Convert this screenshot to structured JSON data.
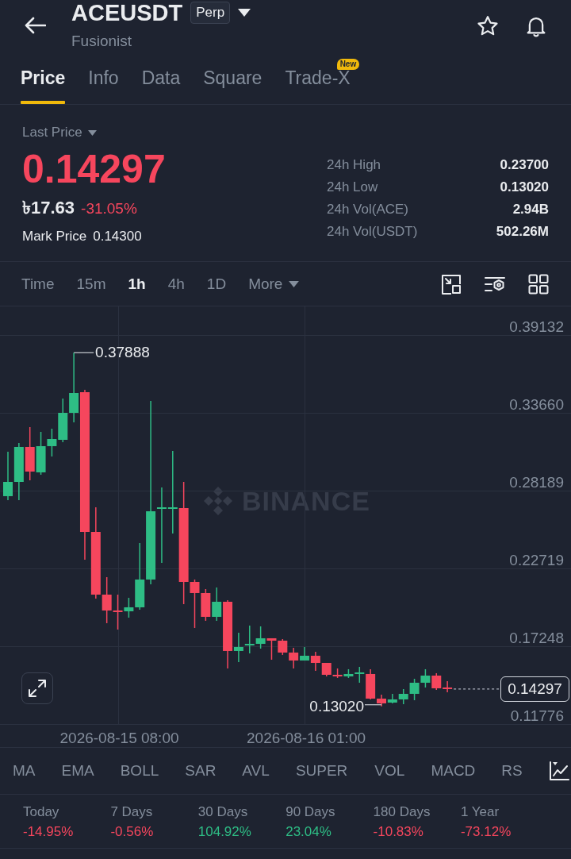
{
  "header": {
    "title": "ACEUSDT",
    "badge": "Perp",
    "subtitle": "Fusionist"
  },
  "tabs": [
    {
      "label": "Price",
      "selected": true
    },
    {
      "label": "Info",
      "selected": false
    },
    {
      "label": "Data",
      "selected": false
    },
    {
      "label": "Square",
      "selected": false
    },
    {
      "label": "Trade-X",
      "selected": false,
      "badge": "New"
    }
  ],
  "price": {
    "label": "Last Price",
    "value": "0.14297",
    "down": true,
    "fiat_value": "৳17.63",
    "change": "-31.05%",
    "mark_price_label": "Mark Price",
    "mark_price": "0.14300"
  },
  "stats_24h": [
    {
      "label": "24h High",
      "value": "0.23700"
    },
    {
      "label": "24h Low",
      "value": "0.13020"
    },
    {
      "label": "24h Vol(ACE)",
      "value": "2.94B"
    },
    {
      "label": "24h Vol(USDT)",
      "value": "502.26M"
    }
  ],
  "intervals": [
    {
      "label": "Time",
      "kind": "option",
      "selected": false
    },
    {
      "label": "15m",
      "kind": "option",
      "selected": false
    },
    {
      "label": "1h",
      "kind": "option",
      "selected": true
    },
    {
      "label": "4h",
      "kind": "option",
      "selected": false
    },
    {
      "label": "1D",
      "kind": "option",
      "selected": false
    },
    {
      "label": "More",
      "kind": "dropdown",
      "selected": false
    }
  ],
  "chart": {
    "high_marker": "0.37888",
    "low_marker": "0.13020",
    "current_price_tag": "0.14297",
    "watermark": "BINANCE",
    "chart_data": {
      "type": "candlestick",
      "categories": [
        null,
        null,
        null,
        null,
        null,
        null,
        null,
        null,
        null,
        null,
        "2026-08-15 08:00",
        null,
        null,
        null,
        null,
        null,
        null,
        null,
        null,
        null,
        null,
        null,
        null,
        null,
        null,
        null,
        null,
        "2026-08-16 01:00",
        null,
        null,
        null,
        null,
        null,
        null,
        null,
        null,
        null,
        null,
        null,
        null,
        null
      ],
      "ohlc": [
        [
          0.278,
          0.30926,
          0.2752,
          0.28804
        ],
        [
          0.28804,
          0.3154,
          0.2752,
          0.31261
        ],
        [
          0.31261,
          0.32656,
          0.28916,
          0.2953
        ],
        [
          0.29474,
          0.32321,
          0.29307,
          0.31317
        ],
        [
          0.31317,
          0.32545,
          0.30591,
          0.31819
        ],
        [
          0.31763,
          0.34666,
          0.31596,
          0.33661
        ],
        [
          0.33661,
          0.37888,
          0.32991,
          0.35057
        ],
        [
          0.35113,
          0.3528,
          0.23334,
          0.25287
        ],
        [
          0.25287,
          0.27018,
          0.20598,
          0.20877
        ],
        [
          0.20877,
          0.22105,
          0.18868,
          0.19761
        ],
        [
          0.19761,
          0.20877,
          0.18421,
          0.19649
        ],
        [
          0.19705,
          0.20654,
          0.19258,
          0.19984
        ],
        [
          0.19984,
          0.24506,
          0.19817,
          0.21938
        ],
        [
          0.21938,
          0.34499,
          0.21603,
          0.26739
        ],
        [
          0.26906,
          0.28414,
          0.2311,
          0.27018
        ],
        [
          0.26906,
          0.30982,
          0.25176,
          0.27018
        ],
        [
          0.26962,
          0.28804,
          0.20207,
          0.2177
        ],
        [
          0.2177,
          0.21938,
          0.18533,
          0.20989
        ],
        [
          0.20989,
          0.21268,
          0.19035,
          0.19314
        ],
        [
          0.19314,
          0.2138,
          0.19035,
          0.20375
        ],
        [
          0.20375,
          0.20486,
          0.15686,
          0.16914
        ],
        [
          0.16914,
          0.18198,
          0.16132,
          0.17193
        ],
        [
          0.17304,
          0.187,
          0.16746,
          0.17416
        ],
        [
          0.17416,
          0.18644,
          0.17081,
          0.17807
        ],
        [
          0.17807,
          0.17807,
          0.163,
          0.17639
        ],
        [
          0.17639,
          0.17751,
          0.16635,
          0.16802
        ],
        [
          0.16802,
          0.17137,
          0.15686,
          0.16244
        ],
        [
          0.16244,
          0.17193,
          0.16244,
          0.16579
        ],
        [
          0.16579,
          0.16858,
          0.15518,
          0.16076
        ],
        [
          0.16076,
          0.16076,
          0.15127,
          0.15239
        ],
        [
          0.15239,
          0.15686,
          0.15016,
          0.15127
        ],
        [
          0.15127,
          0.1563,
          0.15016,
          0.15295
        ],
        [
          0.15295,
          0.15797,
          0.14681,
          0.15406
        ],
        [
          0.15295,
          0.1563,
          0.13508,
          0.13564
        ],
        [
          0.13564,
          0.13843,
          0.1302,
          0.13229
        ],
        [
          0.13285,
          0.13899,
          0.13229,
          0.13508
        ],
        [
          0.13508,
          0.14234,
          0.13173,
          0.13899
        ],
        [
          0.13899,
          0.1496,
          0.13452,
          0.14681
        ],
        [
          0.14681,
          0.1563,
          0.14346,
          0.15183
        ],
        [
          0.15183,
          0.15351,
          0.14178,
          0.1429
        ],
        [
          0.14346,
          0.14792,
          0.14011,
          0.14297
        ]
      ],
      "ylim": [
        0.11776,
        0.41198
      ],
      "yticks": [
        {
          "value": 0.39132,
          "label": "0.39132"
        },
        {
          "value": 0.3366,
          "label": "0.33660"
        },
        {
          "value": 0.28189,
          "label": "0.28189"
        },
        {
          "value": 0.22719,
          "label": "0.22719"
        },
        {
          "value": 0.17248,
          "label": "0.17248"
        },
        {
          "value": 0.11776,
          "label": "0.11776"
        }
      ],
      "grid": true
    }
  },
  "indicators": {
    "main": [
      "MA",
      "EMA",
      "BOLL",
      "SAR",
      "AVL",
      "SUPER"
    ],
    "sub": [
      "VOL",
      "MACD",
      "RS"
    ]
  },
  "period_changes": [
    {
      "label": "Today",
      "value": "-14.95%",
      "color": "#f6465d"
    },
    {
      "label": "7 Days",
      "value": "-0.56%",
      "color": "#f6465d"
    },
    {
      "label": "30 Days",
      "value": "104.92%",
      "color": "#2ebd85"
    },
    {
      "label": "90 Days",
      "value": "23.04%",
      "color": "#2ebd85"
    },
    {
      "label": "180 Days",
      "value": "-10.83%",
      "color": "#f6465d"
    },
    {
      "label": "1 Year",
      "value": "-73.12%",
      "color": "#f6465d"
    }
  ]
}
